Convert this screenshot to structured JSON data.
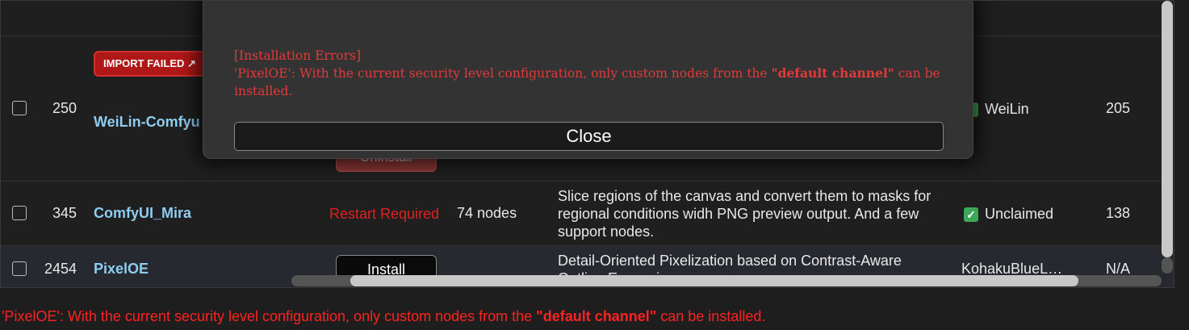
{
  "modal": {
    "heading": "[Installation Errors]",
    "message_prefix": "'PixelOE': With the current security level configuration, only custom nodes from the ",
    "message_emphasis": "\"default channel\"",
    "message_suffix": " can be installed.",
    "close_label": "Close"
  },
  "rows": [
    {
      "id": "250",
      "title": "WeiLin-Comfyu",
      "badge": "IMPORT FAILED ↗",
      "action_label": "Uninstall",
      "author": "WeiLin",
      "stars": "205"
    },
    {
      "id": "345",
      "title": "ComfyUI_Mira",
      "status": "Restart Required",
      "nodes": "74 nodes",
      "description": "Slice regions of the canvas and convert them to masks for regional conditions widh PNG preview output. And a few support nodes.",
      "author": "Unclaimed",
      "stars": "138"
    },
    {
      "id": "2454",
      "title": "PixelOE",
      "action_label": "Install",
      "description": "Detail-Oriented Pixelization based on Contrast-Aware Outline Expansion.",
      "author": "KohakuBlueL…",
      "stars": "N/A"
    }
  ],
  "footer": {
    "prefix": "'PixelOE': With the current security level configuration, only custom nodes from the ",
    "emphasis": "\"default channel\"",
    "suffix": " can be installed."
  },
  "colors": {
    "error_red": "#ff2222",
    "title_blue": "#8ecdf1",
    "badge_red": "#b01818",
    "check_green": "#3ca85a"
  }
}
